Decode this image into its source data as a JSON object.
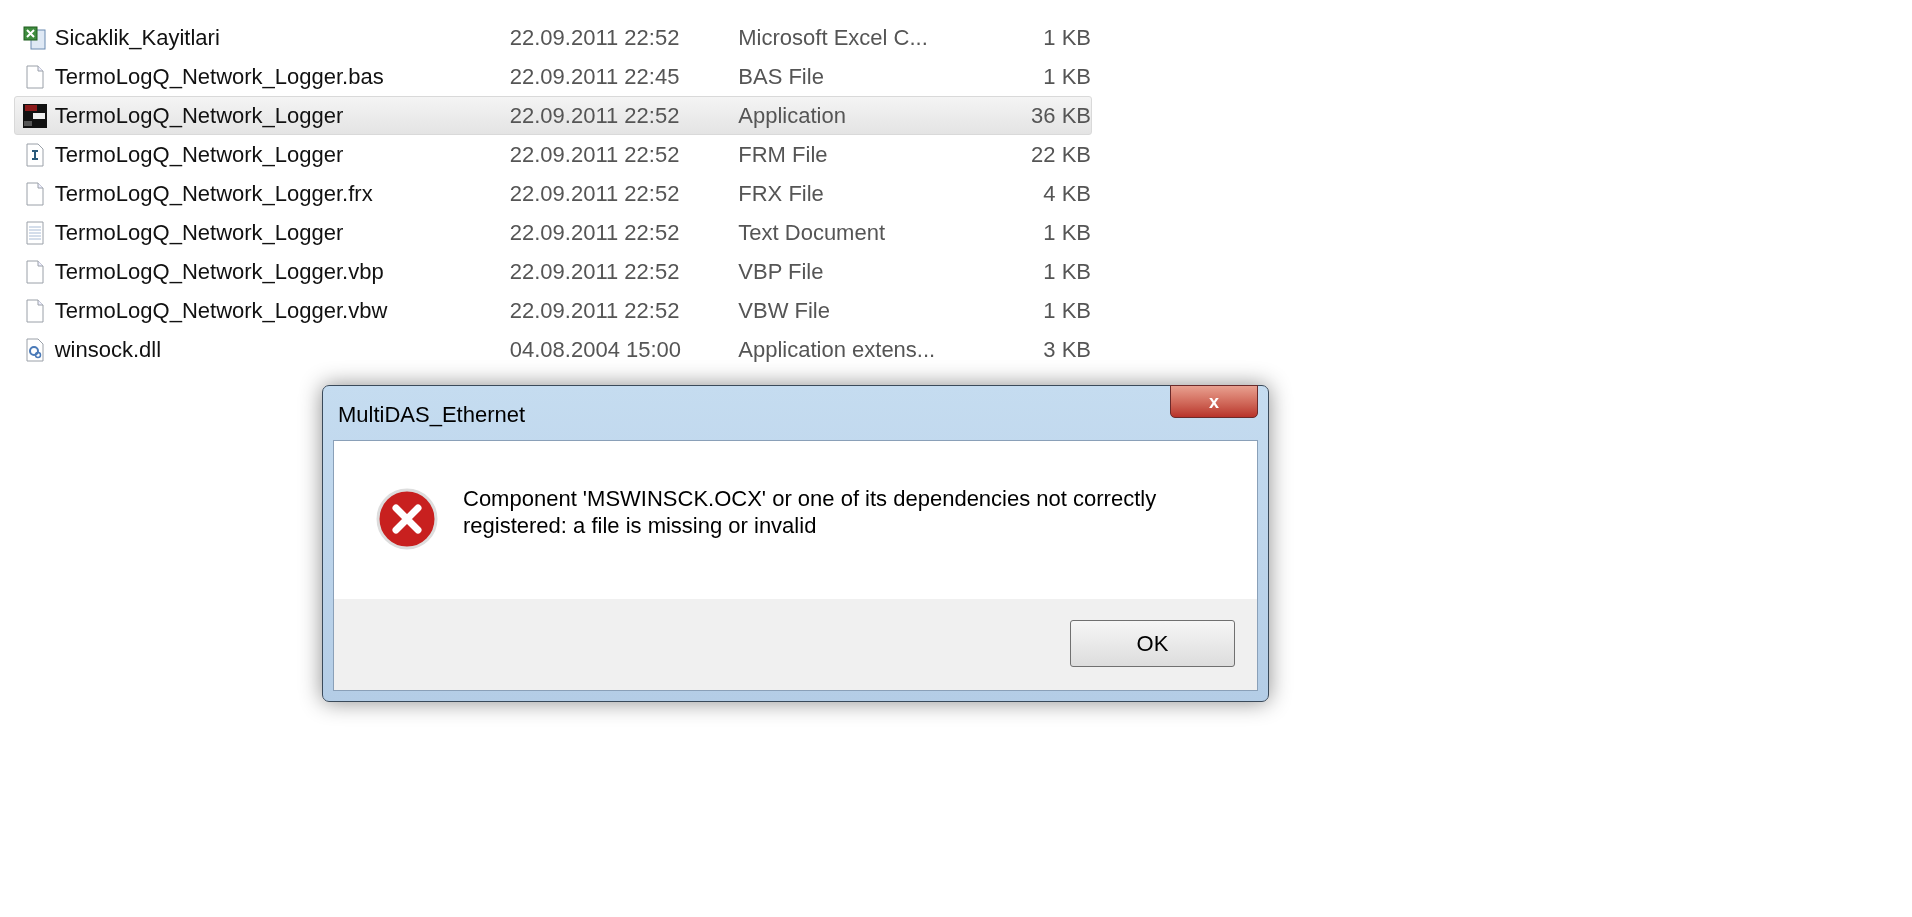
{
  "files": [
    {
      "kind": "excel",
      "name": "Sicaklik_Kayitlari",
      "date": "22.09.2011 22:52",
      "type": "Microsoft Excel C...",
      "size": "1 KB",
      "selected": false
    },
    {
      "kind": "blank",
      "name": "TermoLogQ_Network_Logger.bas",
      "date": "22.09.2011 22:45",
      "type": "BAS File",
      "size": "1 KB",
      "selected": false
    },
    {
      "kind": "app",
      "name": "TermoLogQ_Network_Logger",
      "date": "22.09.2011 22:52",
      "type": "Application",
      "size": "36 KB",
      "selected": true
    },
    {
      "kind": "form",
      "name": "TermoLogQ_Network_Logger",
      "date": "22.09.2011 22:52",
      "type": "FRM File",
      "size": "22 KB",
      "selected": false
    },
    {
      "kind": "blank",
      "name": "TermoLogQ_Network_Logger.frx",
      "date": "22.09.2011 22:52",
      "type": "FRX File",
      "size": "4 KB",
      "selected": false
    },
    {
      "kind": "text",
      "name": "TermoLogQ_Network_Logger",
      "date": "22.09.2011 22:52",
      "type": "Text Document",
      "size": "1 KB",
      "selected": false
    },
    {
      "kind": "blank",
      "name": "TermoLogQ_Network_Logger.vbp",
      "date": "22.09.2011 22:52",
      "type": "VBP File",
      "size": "1 KB",
      "selected": false
    },
    {
      "kind": "blank",
      "name": "TermoLogQ_Network_Logger.vbw",
      "date": "22.09.2011 22:52",
      "type": "VBW File",
      "size": "1 KB",
      "selected": false
    },
    {
      "kind": "dll",
      "name": "winsock.dll",
      "date": "04.08.2004 15:00",
      "type": "Application extens...",
      "size": "3 KB",
      "selected": false
    }
  ],
  "dialog": {
    "title": "MultiDAS_Ethernet",
    "close": "x",
    "message": "Component 'MSWINSCK.OCX' or one of its dependencies not correctly registered: a file is missing or invalid",
    "buttons": [
      "OK"
    ]
  }
}
